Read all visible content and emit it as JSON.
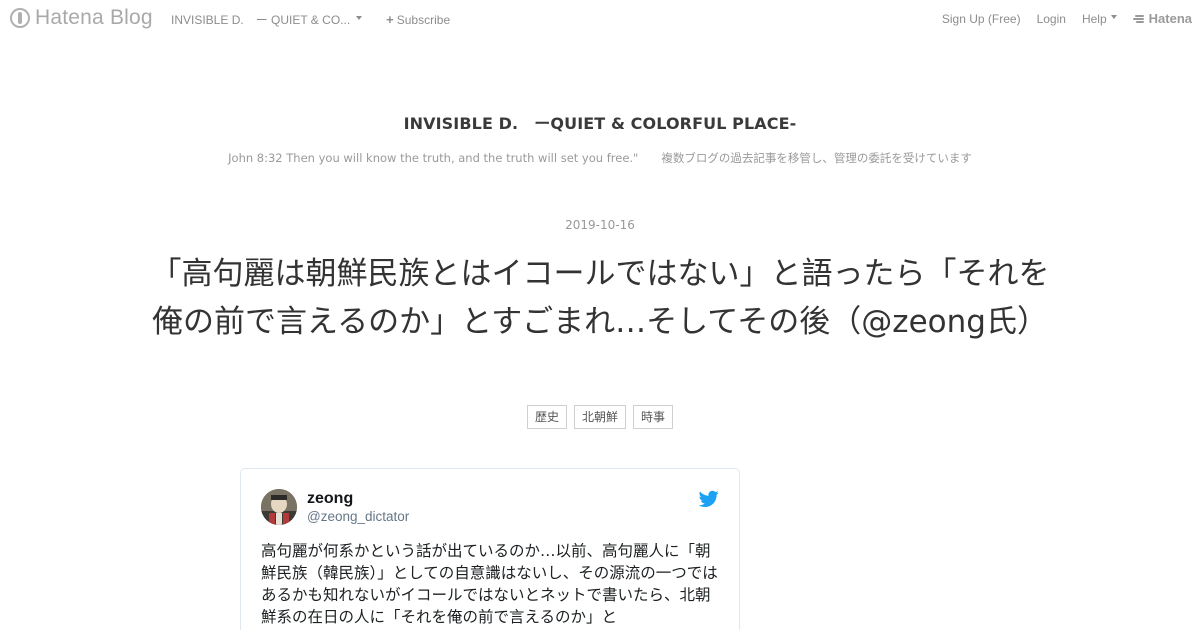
{
  "topbar": {
    "brand": "Hatena Blog",
    "blog_title_link": "INVISIBLE D.　ー QUIET & CO...",
    "subscribe": "Subscribe",
    "signup": "Sign Up (Free)",
    "login": "Login",
    "help": "Help",
    "hatena": "Hatena"
  },
  "header": {
    "blog_name": "INVISIBLE D.　ーQUIET & COLORFUL PLACE-",
    "description": "John 8:32 Then you will know the truth, and the truth will set you free.\"　　複数ブログの過去記事を移管し、管理の委託を受けています"
  },
  "entry": {
    "date": "2019-10-16",
    "title": "「高句麗は朝鮮民族とはイコールではない」と語ったら「それを俺の前で言えるのか」とすごまれ…そしてその後（@zeong氏）",
    "categories": [
      "歴史",
      "北朝鮮",
      "時事"
    ]
  },
  "tweet": {
    "name": "zeong",
    "handle": "@zeong_dictator",
    "text": "高句麗が何系かという話が出ているのか…以前、高句麗人に「朝鮮民族（韓民族）」としての自意識はないし、その源流の一つではあるかも知れないがイコールではないとネットで書いたら、北朝鮮系の在日の人に「それを俺の前で言えるのか」と"
  },
  "colors": {
    "twitter_blue": "#1da1f2",
    "muted_gray": "#8d8d8d"
  }
}
